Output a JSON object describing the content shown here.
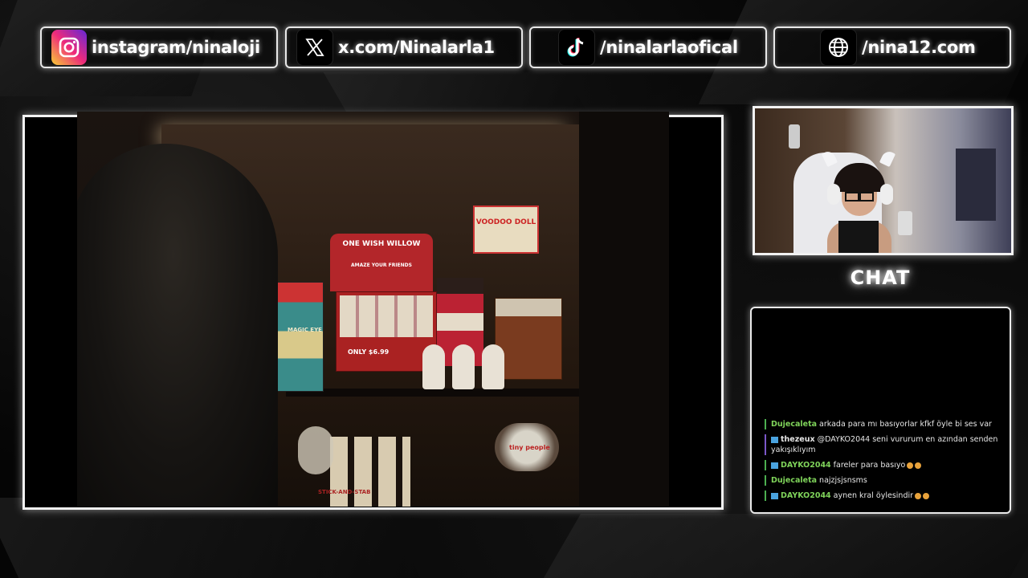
{
  "social": [
    {
      "icon": "instagram-icon",
      "label": "instagram/ninaloji"
    },
    {
      "icon": "x-icon",
      "label": "x.com/Ninalarla1"
    },
    {
      "icon": "tiktok-icon",
      "label": "/ninalarlaofical"
    },
    {
      "icon": "globe-icon",
      "label": "/nina12.com"
    }
  ],
  "game": {
    "poster_voodoo": "VOODOO DOLL",
    "sign_one_wish": "ONE WISH WILLOW",
    "sign_sub": "AMAZE YOUR FRIENDS",
    "price": "ONLY $6.99",
    "box_magic_eye": "MAGIC EYE",
    "stick_label": "STICK-AND-STAB",
    "tiny_label": "tiny people"
  },
  "chat": {
    "title": "CHAT",
    "messages": [
      {
        "user": "Dujecaleta",
        "user_color": "#7fd35a",
        "badge": false,
        "text": "arkada para mı basıyorlar kfkf öyle bi ses var",
        "line": "green",
        "emojis": 0
      },
      {
        "user": "thezeux",
        "user_color": "#e6e6e6",
        "badge": true,
        "text": "@DAYKO2044 seni vururum en azından senden yakışıklıyım",
        "line": "purple",
        "emojis": 0
      },
      {
        "user": "DAYKO2044",
        "user_color": "#7fd35a",
        "badge": true,
        "text": "fareler para basıyo",
        "line": "green",
        "emojis": 2
      },
      {
        "user": "Dujecaleta",
        "user_color": "#7fd35a",
        "badge": false,
        "text": "najzjsjsnsms",
        "line": "green",
        "emojis": 0
      },
      {
        "user": "DAYKO2044",
        "user_color": "#7fd35a",
        "badge": true,
        "text": "aynen kral öylesindir",
        "line": "green",
        "emojis": 2
      }
    ]
  },
  "colors": {
    "accent": "#ffffff",
    "chat_user": "#7fd35a",
    "badge": "#4aa3df"
  }
}
